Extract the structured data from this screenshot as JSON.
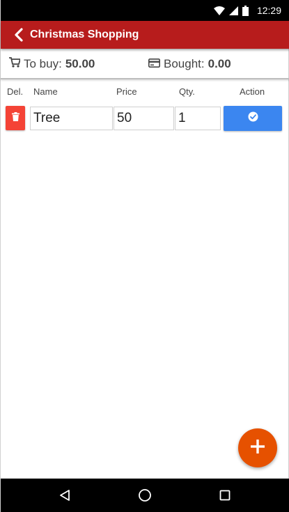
{
  "status_bar": {
    "time": "12:29",
    "icons": [
      "wifi-icon",
      "signal-icon",
      "battery-icon"
    ]
  },
  "app_bar": {
    "title": "Christmas Shopping",
    "back_icon": "chevron-left-icon",
    "background_color": "#b71c1c"
  },
  "summary": {
    "to_buy_label": "To buy:",
    "to_buy_value": "50.00",
    "to_buy_icon": "cart-icon",
    "bought_label": "Bought:",
    "bought_value": "0.00",
    "bought_icon": "credit-card-icon"
  },
  "table": {
    "columns": [
      "Del.",
      "Name",
      "Price",
      "Qty.",
      "Action"
    ],
    "rows": [
      {
        "name": "Tree",
        "price": "50",
        "qty": "1",
        "delete_icon": "trash-icon",
        "action_icon": "check-circle-icon"
      }
    ]
  },
  "fab": {
    "icon": "plus-icon",
    "color": "#e65100"
  },
  "colors": {
    "delete": "#f44336",
    "action": "#3b86f0"
  },
  "nav_bar": {
    "buttons": [
      "back-triangle-icon",
      "home-circle-icon",
      "recents-square-icon"
    ]
  }
}
